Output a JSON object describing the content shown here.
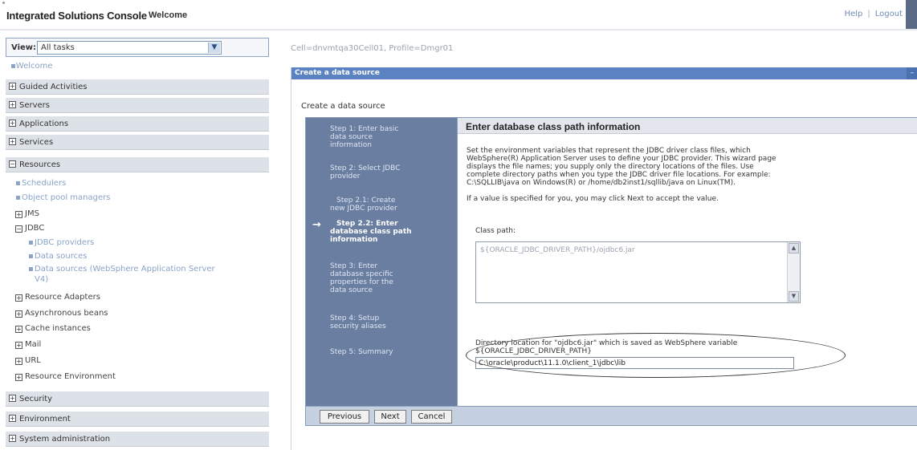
{
  "banner": {
    "app_title": "Integrated Solutions Console",
    "welcome": "Welcome",
    "help": "Help",
    "separator": "|",
    "logout": "Logout"
  },
  "nav": {
    "view_label": "View:",
    "view_value": "All tasks",
    "welcome_link": "Welcome",
    "categories": {
      "guided": "Guided Activities",
      "servers": "Servers",
      "applications": "Applications",
      "services": "Services",
      "resources": "Resources",
      "security": "Security",
      "environment": "Environment",
      "system_admin": "System administration"
    },
    "resources_items": {
      "schedulers": "Schedulers",
      "object_pool": "Object pool managers",
      "jms": "JMS",
      "jdbc": "JDBC",
      "jdbc_providers": "JDBC providers",
      "data_sources": "Data sources",
      "data_sources_v4_line1": "Data sources (WebSphere Application Server",
      "data_sources_v4_line2": "V4)",
      "resource_adapters": "Resource Adapters",
      "async_beans": "Asynchronous beans",
      "cache_instances": "Cache instances",
      "mail": "Mail",
      "url": "URL",
      "resource_env": "Resource Environment"
    }
  },
  "main": {
    "breadcrumb": "Cell=dnvmtqa30Cell01, Profile=Dmgr01",
    "portlet_title": "Create a data source",
    "portlet_subtitle": "Create a data source",
    "steps": {
      "s1": [
        "Step 1: Enter basic",
        "data source",
        "information"
      ],
      "s2": [
        "Step 2: Select JDBC",
        "provider"
      ],
      "s21": [
        "Step 2.1: Create",
        "new JDBC provider"
      ],
      "s22": [
        "Step 2.2: Enter",
        "database class path",
        "information"
      ],
      "s3": [
        "Step 3: Enter",
        "database specific",
        "properties for the",
        "data source"
      ],
      "s4": [
        "Step 4: Setup",
        "security aliases"
      ],
      "s5": [
        "Step 5: Summary"
      ]
    },
    "content_title": "Enter database class path information",
    "description_lines": [
      "Set the environment variables that represent the JDBC driver class files, which",
      "WebSphere(R) Application Server uses to define your JDBC provider. This wizard page",
      "displays the file names; you supply only the directory locations of the files. Use",
      "complete directory paths when you type the JDBC driver file locations. For example:",
      "C:\\SQLLIB\\java on Windows(R) or /home/db2inst1/sqllib/java on Linux(TM)."
    ],
    "note": "If a value is specified for you, you may click Next to accept the value.",
    "class_path_label": "Class path:",
    "class_path_value": "${ORACLE_JDBC_DRIVER_PATH}/ojdbc6.jar",
    "dir_label_line1": "Directory location for \"ojdbc6.jar\" which is saved as WebSphere variable",
    "dir_label_line2": "${ORACLE_JDBC_DRIVER_PATH}",
    "dir_value": "C:\\oracle\\product\\11.1.0\\client_1\\jdbc\\lib",
    "buttons": {
      "previous": "Previous",
      "next": "Next",
      "cancel": "Cancel"
    }
  }
}
